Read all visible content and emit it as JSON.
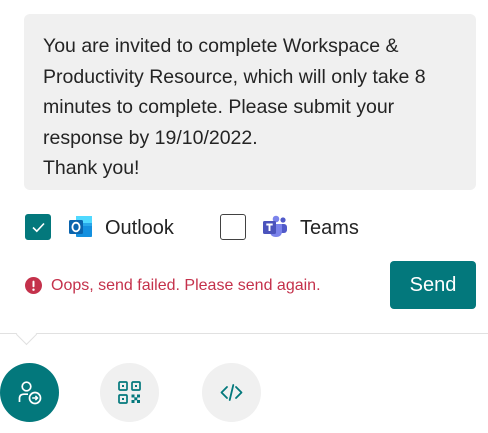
{
  "message": {
    "text": "You are invited to complete Workspace &\nProductivity Resource, which will only take 8\nminutes to complete. Please submit your\nresponse by 19/10/2022.\nThank you!"
  },
  "channels": [
    {
      "label": "Outlook",
      "checked": true,
      "icon": "outlook-icon"
    },
    {
      "label": "Teams",
      "checked": false,
      "icon": "teams-icon"
    }
  ],
  "error": {
    "text": "Oops, send failed. Please send again.",
    "icon": "error-circle-icon",
    "color": "#c4314b"
  },
  "send_button": {
    "label": "Send"
  },
  "share_options": [
    {
      "name": "send-link",
      "icon": "person-send-icon",
      "active": true
    },
    {
      "name": "qr-code",
      "icon": "qr-code-icon",
      "active": false
    },
    {
      "name": "embed",
      "icon": "code-icon",
      "active": false
    }
  ],
  "colors": {
    "accent": "#03787c",
    "error": "#c4314b",
    "message_bg": "#f0f0f0",
    "inactive_button_bg": "#f0f0f0"
  }
}
